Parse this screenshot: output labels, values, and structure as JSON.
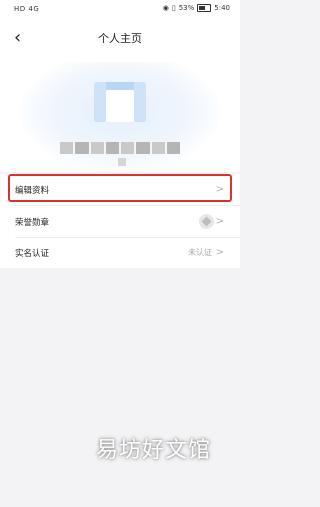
{
  "status_bar": {
    "left": "HD 4G",
    "battery_percent": "53%",
    "time": "5:40"
  },
  "header": {
    "back_icon": "chevron-left-icon",
    "title": "个人主页"
  },
  "menu": {
    "items": [
      {
        "label": "编辑资料",
        "value": "",
        "chevron": ">"
      },
      {
        "label": "荣誉勋章",
        "value": "",
        "chevron": ">"
      },
      {
        "label": "实名认证",
        "value": "未认证",
        "chevron": ">"
      }
    ]
  },
  "watermark": "易坊好文馆",
  "colors": {
    "highlight": "#d9342b",
    "avatar": "#cfe2f7",
    "background": "#f3f3f5"
  }
}
